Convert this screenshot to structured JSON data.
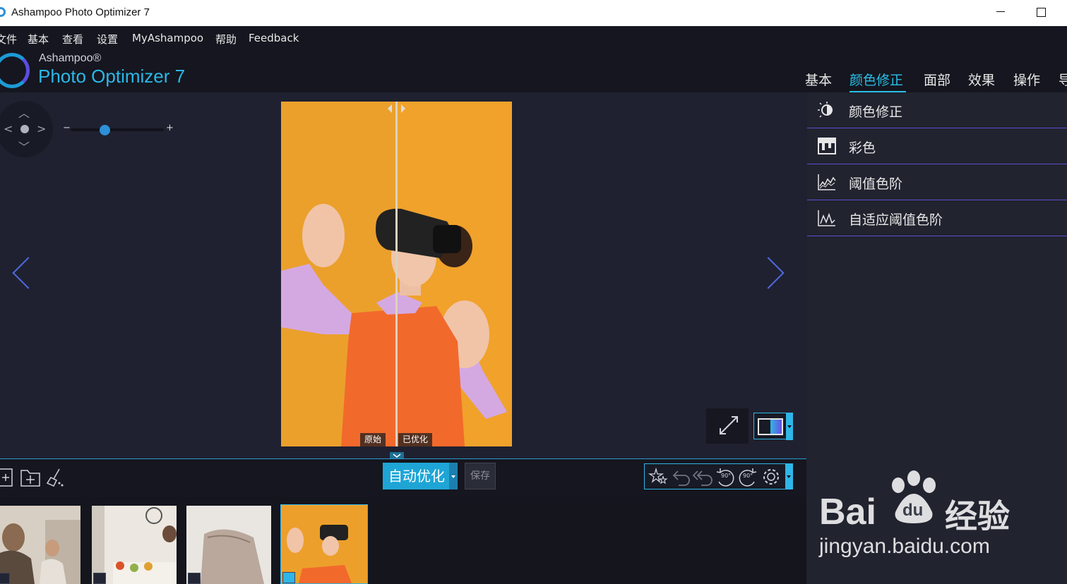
{
  "window": {
    "title": "Ashampoo Photo Optimizer 7"
  },
  "menu": [
    "文件",
    "基本",
    "查看",
    "设置",
    "MyAshampoo",
    "帮助",
    "Feedback"
  ],
  "logo": {
    "brand": "Ashampoo®",
    "product": "Photo Optimizer 7"
  },
  "tabs": [
    {
      "label": "基本",
      "active": false
    },
    {
      "label": "颜色修正",
      "active": true
    },
    {
      "label": "面部",
      "active": false
    },
    {
      "label": "效果",
      "active": false
    },
    {
      "label": "操作",
      "active": false
    },
    {
      "label": "导",
      "active": false
    }
  ],
  "zoom": {
    "minus": "−",
    "plus": "+",
    "level_fraction": 0.4
  },
  "compare": {
    "original_label": "原始",
    "optimized_label": "已优化"
  },
  "panel_items": [
    {
      "label": "颜色修正",
      "icon": "brightness-icon"
    },
    {
      "label": "彩色",
      "icon": "color-icon"
    },
    {
      "label": "阈值色阶",
      "icon": "threshold-icon"
    },
    {
      "label": "自适应阈值色阶",
      "icon": "adaptive-threshold-icon"
    }
  ],
  "toolbar": {
    "auto_optimize": "自动优化",
    "save": "保存",
    "rotate_left": "90°",
    "rotate_right": "90°"
  },
  "watermark": {
    "brand": "Bai",
    "du": "du",
    "suffix": "经验",
    "url": "jingyan.baidu.com"
  },
  "colors": {
    "accent": "#29c0e8",
    "divider": "#5a4fcf",
    "background": "#1f2130",
    "photo_bg": "#eca02b"
  }
}
